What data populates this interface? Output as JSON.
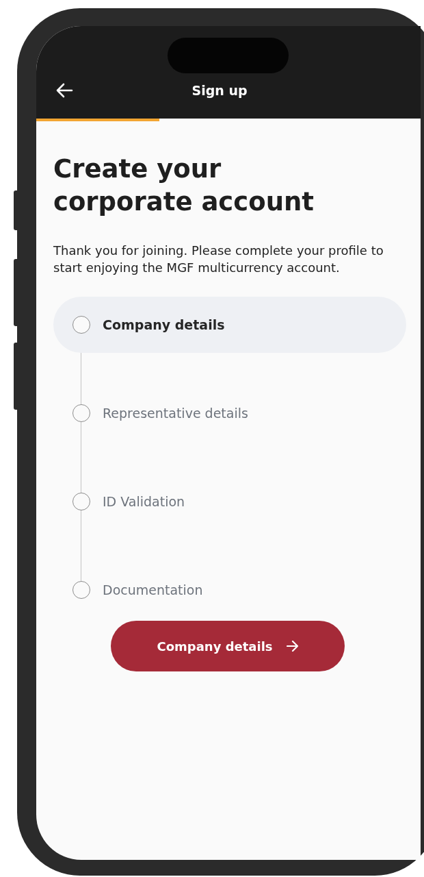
{
  "header": {
    "title": "Sign up"
  },
  "progress": {
    "level": 0.32
  },
  "heading": "Create your corporate account",
  "intro": "Thank you for joining. Please complete your profile to start enjoying the MGF multicurrency account.",
  "steps": [
    {
      "label": "Company details",
      "selected": true
    },
    {
      "label": "Representative details",
      "selected": false
    },
    {
      "label": "ID Validation",
      "selected": false
    },
    {
      "label": "Documentation",
      "selected": false
    }
  ],
  "button": {
    "label": "Company details"
  }
}
